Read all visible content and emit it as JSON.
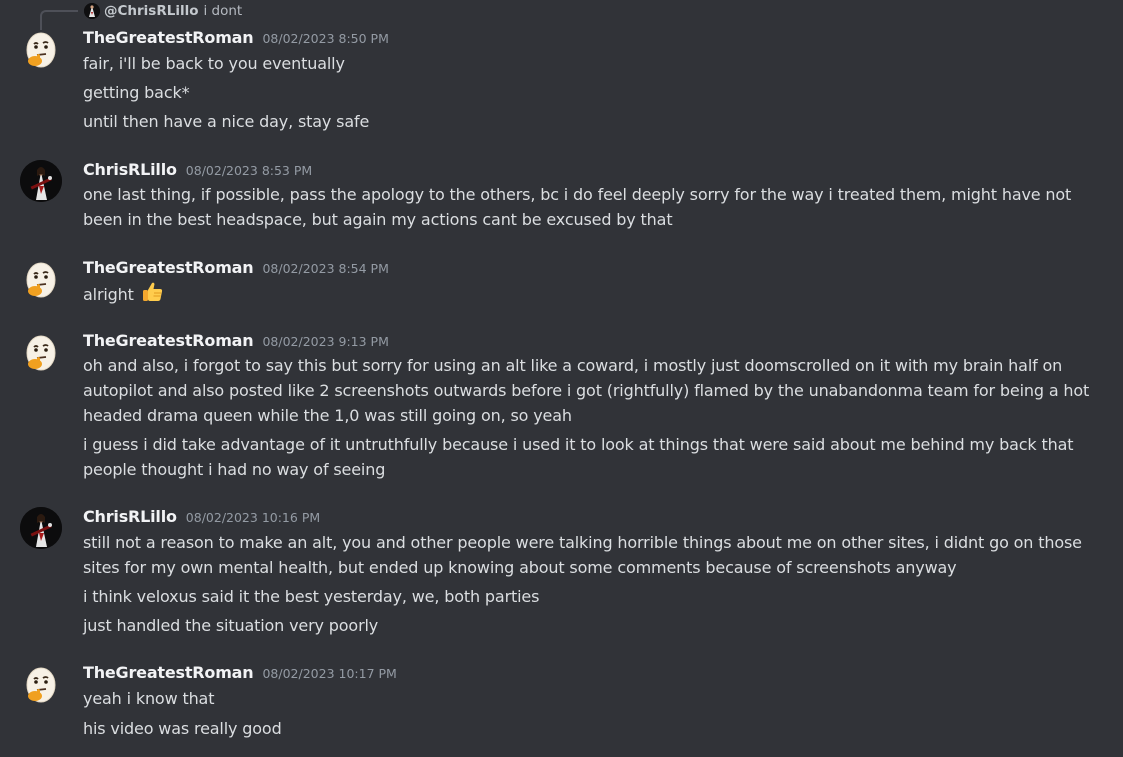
{
  "reply": {
    "mention": "@ChrisRLillo",
    "text": "i dont"
  },
  "groups": [
    {
      "username": "TheGreatestRoman",
      "timestamp": "08/02/2023 8:50 PM",
      "avatar": "egg-thinking-avatar",
      "messages": [
        "fair, i'll be back to you eventually",
        "getting back*",
        "until then have a nice day, stay safe"
      ]
    },
    {
      "username": "ChrisRLillo",
      "timestamp": "08/02/2023 8:53 PM",
      "avatar": "guitarist-avatar",
      "messages": [
        "one last thing, if possible, pass the apology to the others, bc i do feel deeply sorry for the way i treated them, might have not been in the best headspace, but again my actions cant be excused by that"
      ]
    },
    {
      "username": "TheGreatestRoman",
      "timestamp": "08/02/2023 8:54 PM",
      "avatar": "egg-thinking-avatar",
      "messages": [
        "alright"
      ],
      "emoji": "thumbs-up-icon"
    },
    {
      "username": "TheGreatestRoman",
      "timestamp": "08/02/2023 9:13 PM",
      "avatar": "egg-thinking-avatar",
      "messages": [
        "oh and also, i forgot to say this but sorry for using an alt like a coward, i mostly just doomscrolled on it with my brain half on autopilot and also posted like 2 screenshots outwards before i got (rightfully) flamed by the unabandonma team for being a hot headed drama queen while the 1,0 was still going on, so yeah",
        "i guess i did take advantage of it untruthfully because i used it to look at things that were said about me behind my back that people thought i had no way of seeing"
      ]
    },
    {
      "username": "ChrisRLillo",
      "timestamp": "08/02/2023 10:16 PM",
      "avatar": "guitarist-avatar",
      "messages": [
        "still not a reason to make an alt, you and other people were talking horrible things about me on other sites, i didnt go on those sites for my own mental health, but ended up knowing about some comments because of screenshots anyway",
        "i think veloxus said it the best yesterday, we, both parties",
        "just handled the situation very poorly"
      ]
    },
    {
      "username": "TheGreatestRoman",
      "timestamp": "08/02/2023 10:17 PM",
      "avatar": "egg-thinking-avatar",
      "messages": [
        "yeah i know that",
        "his video was really good"
      ]
    }
  ],
  "colors": {
    "background": "#313338",
    "username": "#f2f3f5",
    "timestamp": "#949ba4",
    "message": "#dbdee1"
  }
}
